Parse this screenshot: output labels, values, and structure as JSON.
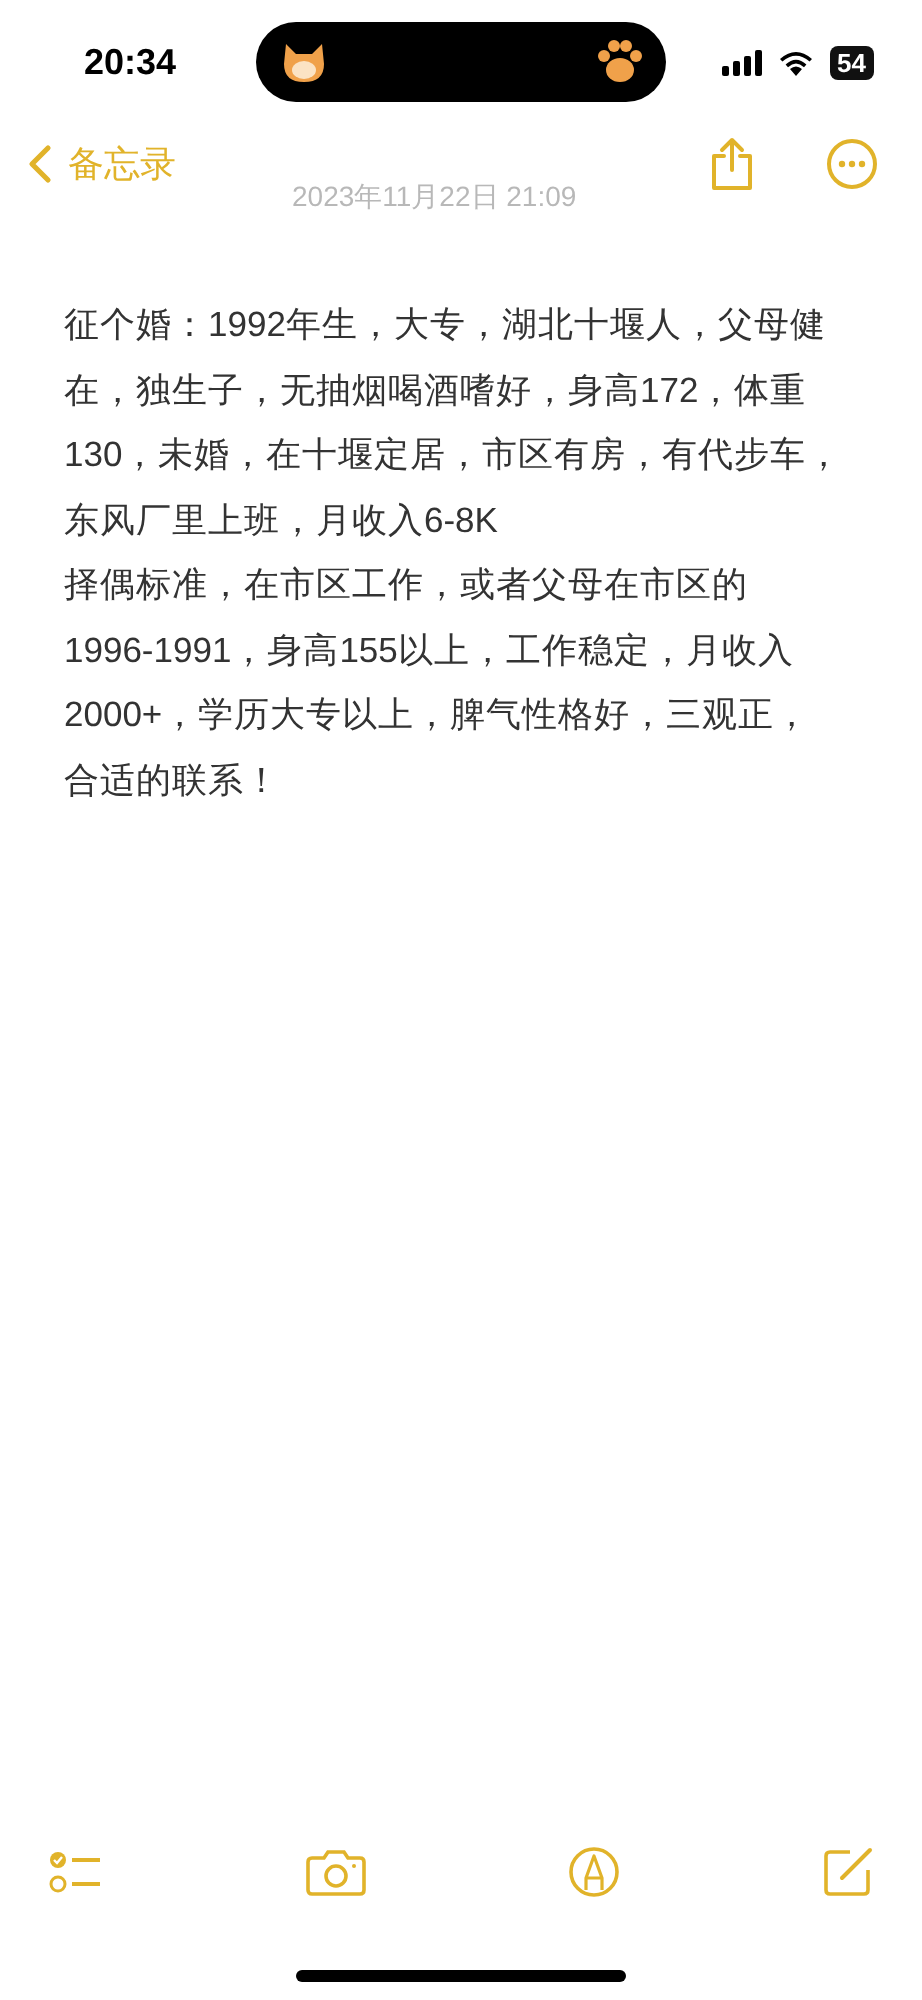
{
  "status_bar": {
    "time": "20:34",
    "battery": "54"
  },
  "nav": {
    "back_label": "备忘录",
    "date": "2023年11月22日 21:09"
  },
  "note": {
    "lines": [
      "征个婚：1992年生，大专，湖北十堰人，父母健",
      "在，独生子，无抽烟喝酒嗜好，身高172，体重",
      "130，未婚，在十堰定居，市区有房，有代步车，",
      "东风厂里上班，月收入6-8K",
      "择偶标准，在市区工作，或者父母在市区的",
      "1996-1991，身高155以上，工作稳定，月收入",
      "2000+，学历大专以上，脾气性格好，三观正，",
      "合适的联系！"
    ]
  }
}
